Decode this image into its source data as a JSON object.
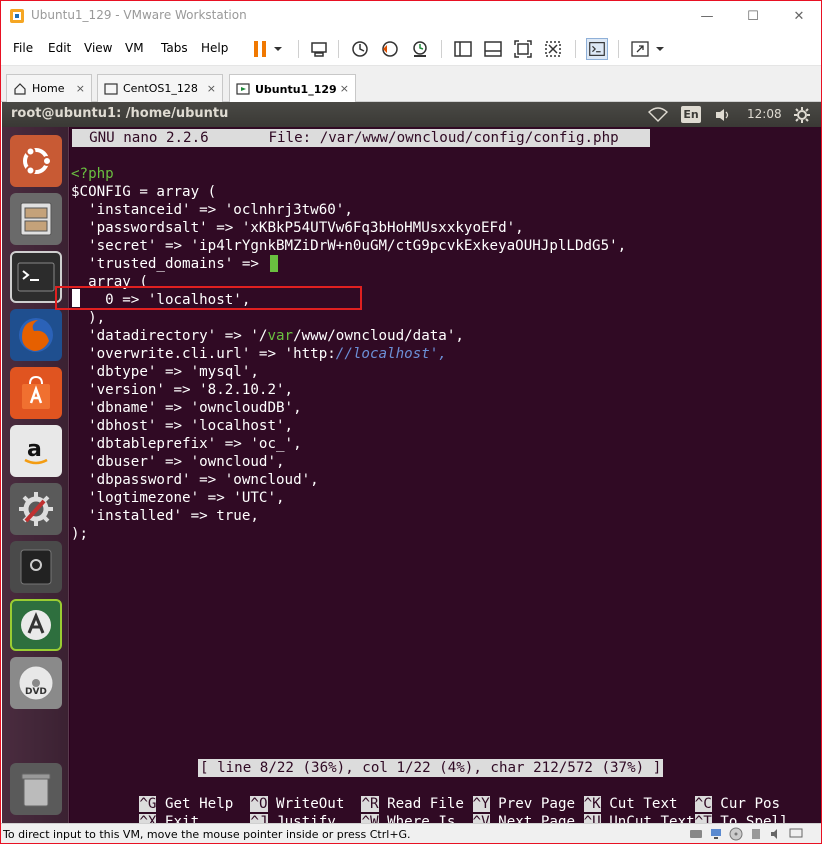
{
  "window": {
    "title": "Ubuntu1_129 - VMware Workstation",
    "minimize_glyph": "—",
    "maximize_glyph": "☐",
    "close_glyph": "✕"
  },
  "menu": {
    "items": [
      "File",
      "Edit",
      "View",
      "VM",
      "Tabs",
      "Help"
    ]
  },
  "tabs": [
    {
      "label": "Home",
      "icon": "home-icon"
    },
    {
      "label": "CentOS1_128",
      "icon": "vm-icon"
    },
    {
      "label": "Ubuntu1_129",
      "icon": "vm-running-icon",
      "active": true
    }
  ],
  "tab_close_glyph": "×",
  "ubuntu_panel": {
    "title": "root@ubuntu1: /home/ubuntu",
    "keyboard_layout": "En",
    "clock": "12:08"
  },
  "nano": {
    "header": "  GNU nano 2.2.6       File: /var/www/owncloud/config/config.php",
    "status": "[ line 8/22 (36%), col 1/22 (4%), char 212/572 (37%) ]",
    "shortcuts_row1": [
      {
        "key": "^G",
        "label": " Get Help  "
      },
      {
        "key": "^O",
        "label": " WriteOut  "
      },
      {
        "key": "^R",
        "label": " Read File "
      },
      {
        "key": "^Y",
        "label": " Prev Page "
      },
      {
        "key": "^K",
        "label": " Cut Text  "
      },
      {
        "key": "^C",
        "label": " Cur Pos"
      }
    ],
    "shortcuts_row2": [
      {
        "key": "^X",
        "label": " Exit      "
      },
      {
        "key": "^J",
        "label": " Justify   "
      },
      {
        "key": "^W",
        "label": " Where Is  "
      },
      {
        "key": "^V",
        "label": " Next Page "
      },
      {
        "key": "^U",
        "label": " UnCut Text"
      },
      {
        "key": "^T",
        "label": " To Spell"
      }
    ]
  },
  "code": {
    "php_open": "<?php",
    "line_config": "$CONFIG = array (",
    "line_instanceid": "  'instanceid' => 'oclnhrj3tw60',",
    "line_passwordsalt": "  'passwordsalt' => 'xKBkP54UTVw6Fq3bHoHMUsxxkyoEFd',",
    "line_secret": "  'secret' => 'ip4lrYgnkBMZiDrW+n0uGM/ctG9pcvkExkeyaOUHJplLDdG5',",
    "line_trusted": "  'trusted_domains' =>",
    "line_array": "  array (",
    "line_localhost": "    0 => 'localhost',",
    "line_close_arr": "  ),",
    "line_datadir_pre": "  'datadirectory' => '/",
    "line_datadir_var": "var",
    "line_datadir_post": "/www/owncloud/data',",
    "line_overwrite_pre": "  'overwrite.cli.url' => 'http:",
    "line_overwrite_url": "//localhost',",
    "line_dbtype": "  'dbtype' => 'mysql',",
    "line_version": "  'version' => '8.2.10.2',",
    "line_dbname": "  'dbname' => 'owncloudDB',",
    "line_dbhost": "  'dbhost' => 'localhost',",
    "line_dbprefix": "  'dbtableprefix' => 'oc_',",
    "line_dbuser": "  'dbuser' => 'owncloud',",
    "line_dbpassword": "  'dbpassword' => 'owncloud',",
    "line_logtz": "  'logtimezone' => 'UTC',",
    "line_installed": "  'installed' => true,",
    "line_end": ");"
  },
  "statusbar": {
    "message": "To direct input to this VM, move the mouse pointer inside or press Ctrl+G."
  },
  "colors": {
    "terminal_bg": "#300a24",
    "highlight_red": "#e02020",
    "php_green": "#6abf40",
    "url_blue": "#6c8fd6"
  }
}
